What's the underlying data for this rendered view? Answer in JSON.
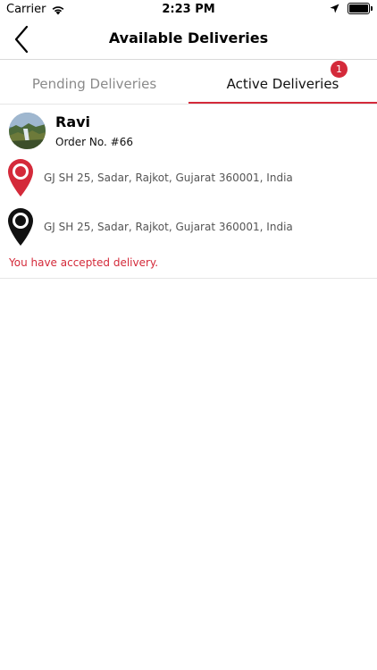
{
  "status_bar": {
    "carrier": "Carrier",
    "time": "2:23 PM",
    "icons": [
      "wifi-icon",
      "location-arrow-icon",
      "battery-icon"
    ]
  },
  "nav": {
    "title": "Available Deliveries",
    "back_icon": "chevron-left-icon"
  },
  "tabs": [
    {
      "label": "Pending Deliveries",
      "selected": false
    },
    {
      "label": "Active Deliveries",
      "selected": true,
      "badge": "1"
    }
  ],
  "colors": {
    "accent": "#d42a3a",
    "muted_text": "#8a8a8a",
    "address_text": "#555555",
    "divider": "#e6e6e6"
  },
  "delivery": {
    "customer_name": "Ravi",
    "order_no": "Order No. #66",
    "pickup_address": "GJ SH 25, Sadar, Rajkot, Gujarat 360001, India",
    "drop_address": "GJ SH 25, Sadar, Rajkot, Gujarat 360001, India",
    "status_message": "You have accepted delivery.",
    "pickup_icon": "red-map-pin-icon",
    "drop_icon": "black-map-pin-icon"
  }
}
